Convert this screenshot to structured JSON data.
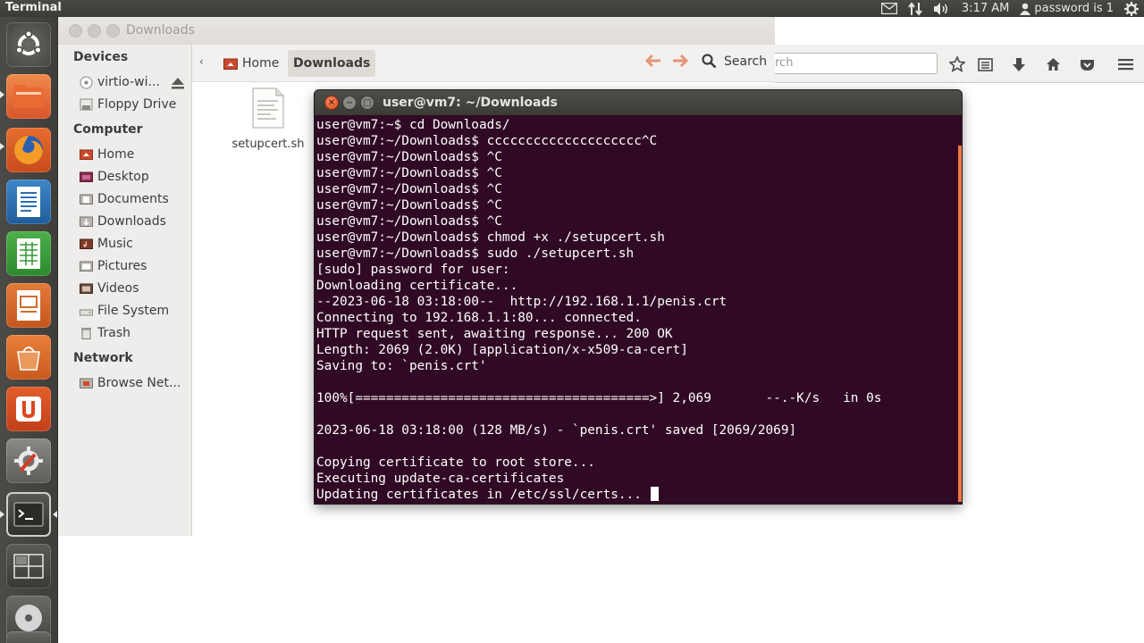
{
  "top_panel": {
    "app_name": "Terminal",
    "time": "3:17 AM",
    "user": "password is 1"
  },
  "launcher": {
    "items": [
      "dash-home",
      "files",
      "firefox",
      "libreoffice-writer",
      "libreoffice-calc",
      "libreoffice-impress",
      "software-center",
      "ubuntu-one",
      "system-settings",
      "terminal",
      "workspace-switcher",
      "dvd-drive",
      "trash"
    ]
  },
  "nautilus": {
    "title": "Downloads",
    "breadcrumbs": [
      "Home",
      "Downloads"
    ],
    "search_label": "Search",
    "sidebar": {
      "devices_heading": "Devices",
      "devices": [
        "virtio-wi...",
        "Floppy Drive"
      ],
      "computer_heading": "Computer",
      "computer": [
        "Home",
        "Desktop",
        "Documents",
        "Downloads",
        "Music",
        "Pictures",
        "Videos",
        "File System",
        "Trash"
      ],
      "network_heading": "Network",
      "network": [
        "Browse Net..."
      ]
    },
    "files": [
      "setupcert.sh"
    ]
  },
  "firefox": {
    "search_placeholder": "rch"
  },
  "terminal": {
    "title": "user@vm7: ~/Downloads",
    "lines": [
      "user@vm7:~$ cd Downloads/",
      "user@vm7:~/Downloads$ cccccccccccccccccccc^C",
      "user@vm7:~/Downloads$ ^C",
      "user@vm7:~/Downloads$ ^C",
      "user@vm7:~/Downloads$ ^C",
      "user@vm7:~/Downloads$ ^C",
      "user@vm7:~/Downloads$ ^C",
      "user@vm7:~/Downloads$ chmod +x ./setupcert.sh",
      "user@vm7:~/Downloads$ sudo ./setupcert.sh",
      "[sudo] password for user:",
      "Downloading certificate...",
      "--2023-06-18 03:18:00--  http://192.168.1.1/penis.crt",
      "Connecting to 192.168.1.1:80... connected.",
      "HTTP request sent, awaiting response... 200 OK",
      "Length: 2069 (2.0K) [application/x-x509-ca-cert]",
      "Saving to: `penis.crt'",
      "",
      "100%[======================================>] 2,069       --.-K/s   in 0s",
      "",
      "2023-06-18 03:18:00 (128 MB/s) - `penis.crt' saved [2069/2069]",
      "",
      "Copying certificate to root store...",
      "Executing update-ca-certificates",
      "Updating certificates in /etc/ssl/certs... "
    ]
  }
}
